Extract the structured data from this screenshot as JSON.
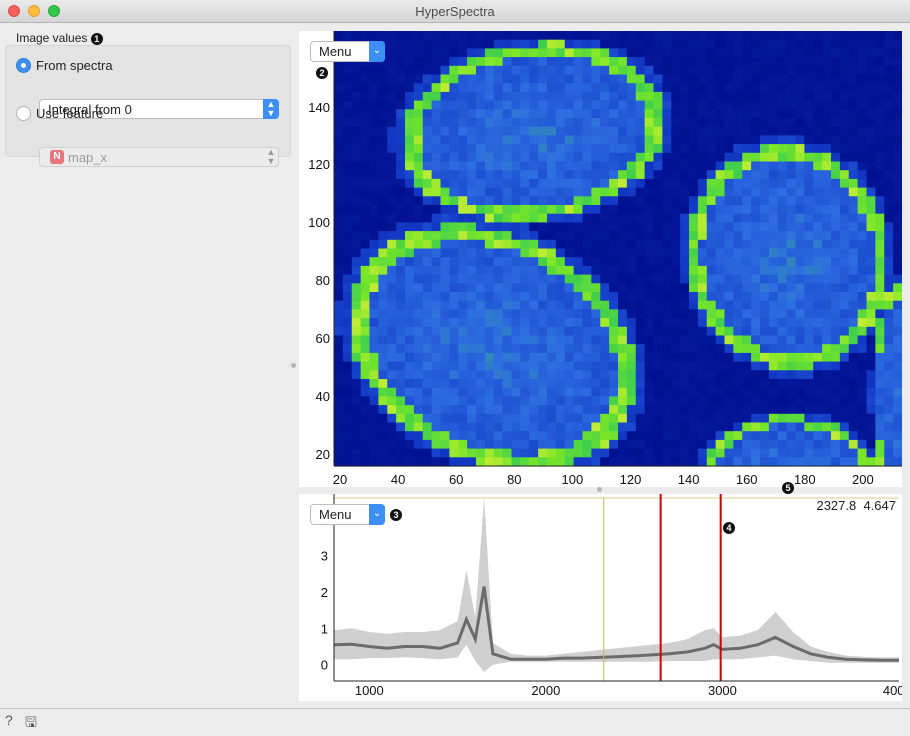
{
  "window": {
    "title": "HyperSpectra"
  },
  "left_panel": {
    "group_title": "Image values",
    "group_badge": "1",
    "from_spectra": {
      "label": "From spectra",
      "selected": true,
      "combo_value": "Integral from 0"
    },
    "use_feature": {
      "label": "Use feature",
      "selected": false,
      "combo_value": "map_x",
      "type_badge": "N"
    }
  },
  "image_plot": {
    "menu_label": "Menu",
    "menu_badge": "2",
    "y_ticks": [
      "20",
      "40",
      "60",
      "80",
      "100",
      "120",
      "140",
      "1"
    ],
    "x_ticks": [
      "20",
      "40",
      "60",
      "80",
      "100",
      "120",
      "140",
      "160",
      "180",
      "200"
    ],
    "colormap": "jet-like: #000e8c low, #2e6be0 mid, #39d23a high, #f5f032 peak"
  },
  "spectra_plot": {
    "menu_label": "Menu",
    "menu_badge": "3",
    "cursor_badge": "4",
    "splitter_badge": "5",
    "coordinate_readout": "2327.8  4.647",
    "y_ticks": [
      "0",
      "1",
      "2",
      "3"
    ],
    "x_ticks": [
      "1000",
      "2000",
      "3000",
      "400"
    ],
    "integral_lines": [
      2650,
      2990
    ],
    "cursor_line": 2327.8,
    "line_color": "#d00000",
    "cursor_color": "#c8b060"
  },
  "chart_data": {
    "type": "line",
    "x": [
      800,
      900,
      1000,
      1100,
      1200,
      1300,
      1400,
      1500,
      1550,
      1600,
      1650,
      1700,
      1800,
      1900,
      2000,
      2100,
      2200,
      2300,
      2400,
      2500,
      2600,
      2700,
      2800,
      2900,
      2950,
      3000,
      3100,
      3200,
      3300,
      3400,
      3500,
      3600,
      3700,
      3800,
      3900,
      4000
    ],
    "series": [
      {
        "values": [
          0.55,
          0.56,
          0.5,
          0.45,
          0.5,
          0.5,
          0.45,
          0.6,
          1.25,
          0.7,
          2.15,
          0.3,
          0.15,
          0.15,
          0.15,
          0.18,
          0.18,
          0.2,
          0.22,
          0.24,
          0.27,
          0.3,
          0.35,
          0.45,
          0.55,
          0.42,
          0.45,
          0.55,
          0.75,
          0.5,
          0.3,
          0.2,
          0.15,
          0.13,
          0.12,
          0.12
        ]
      }
    ],
    "band_lower": [
      0.15,
      0.15,
      0.18,
      0.18,
      0.2,
      0.18,
      0.15,
      0.2,
      0.55,
      0.1,
      -0.2,
      0.0,
      0.08,
      0.08,
      0.08,
      0.08,
      0.08,
      0.08,
      0.08,
      0.08,
      0.08,
      0.1,
      0.1,
      0.1,
      0.15,
      0.15,
      0.15,
      0.2,
      0.25,
      0.15,
      0.1,
      0.05,
      0.05,
      0.05,
      0.05,
      0.05
    ],
    "band_upper": [
      0.95,
      1.0,
      0.9,
      0.85,
      0.9,
      0.9,
      0.95,
      1.2,
      2.6,
      1.3,
      4.6,
      0.6,
      0.3,
      0.25,
      0.25,
      0.3,
      0.35,
      0.4,
      0.45,
      0.5,
      0.55,
      0.6,
      0.7,
      0.95,
      1.0,
      0.75,
      0.8,
      0.95,
      1.45,
      0.9,
      0.5,
      0.35,
      0.25,
      0.22,
      0.2,
      0.2
    ],
    "xlim": [
      800,
      4000
    ],
    "ylim": [
      -0.45,
      4.7
    ],
    "grid": false
  }
}
